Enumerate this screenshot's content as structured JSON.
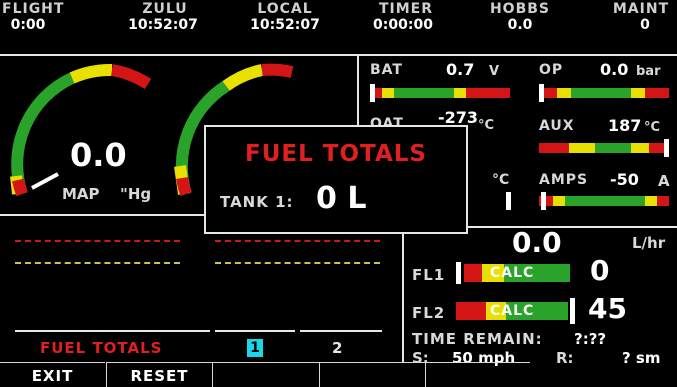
{
  "header": {
    "flight": {
      "label": "FLIGHT",
      "value": "0:00"
    },
    "zulu": {
      "label": "ZULU",
      "value": "10:52:07"
    },
    "local": {
      "label": "LOCAL",
      "value": "10:52:07"
    },
    "timer": {
      "label": "TIMER",
      "value": "0:00:00"
    },
    "hobbs": {
      "label": "HOBBS",
      "value": "0.0"
    },
    "maint": {
      "label": "MAINT",
      "value": "0"
    }
  },
  "gauges": {
    "map": {
      "value": "0.0",
      "label": "MAP",
      "unit": "\"Hg"
    }
  },
  "engine": {
    "bat": {
      "label": "BAT",
      "value": "0.7",
      "unit": "V"
    },
    "op": {
      "label": "OP",
      "value": "0.0",
      "unit": "bar"
    },
    "oat": {
      "label": "OAT",
      "value": "-273",
      "unit": "°C"
    },
    "aux": {
      "label": "AUX",
      "value": "187",
      "unit": "°C"
    },
    "amps": {
      "label": "AMPS",
      "value": "-50",
      "unit": "A"
    },
    "partial_unit": "°C"
  },
  "fuel": {
    "flow_value": "0.0",
    "flow_unit": "L/hr",
    "fl1": {
      "label": "FL1",
      "bar_text": "CALC",
      "value": "0"
    },
    "fl2": {
      "label": "FL2",
      "bar_text": "CALC",
      "value": "45"
    },
    "time_remain_label": "TIME REMAIN:",
    "time_remain_value": "?:??",
    "speed_label": "S:",
    "speed_value": "50 mph",
    "range_label": "R:",
    "range_value": "? sm"
  },
  "popup": {
    "title": "FUEL TOTALS",
    "tank_label": "TANK 1:",
    "tank_value": "0 L"
  },
  "tabs": {
    "fuel_totals": "FUEL TOTALS",
    "tab1": "1",
    "tab2": "2"
  },
  "buttons": {
    "exit": "EXIT",
    "reset": "RESET"
  },
  "colors": {
    "red": "#d41515",
    "yellow": "#e8e000",
    "green": "#2aa32a",
    "title_red": "#e02020",
    "tab_cyan": "#18d8e8"
  }
}
